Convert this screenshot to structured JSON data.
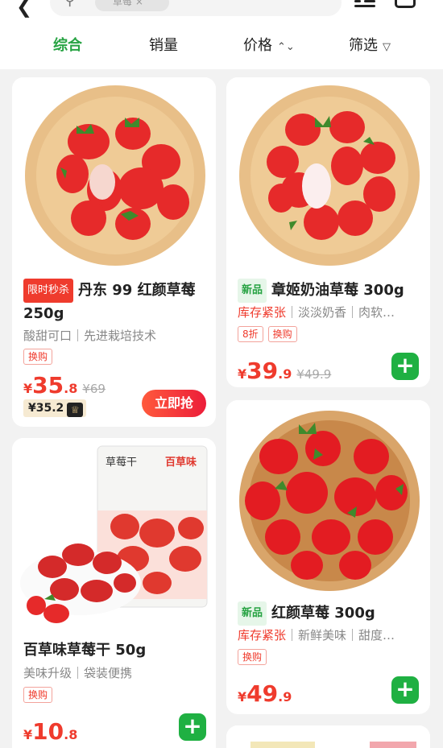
{
  "header": {
    "back_icon": "chevron-left-icon",
    "search_icon": "search-icon",
    "search_chip": "草莓 ×",
    "list_icon": "list-view-icon",
    "cart_icon": "cart-icon"
  },
  "tabs": [
    {
      "label": "综合",
      "active": true
    },
    {
      "label": "销量"
    },
    {
      "label": "价格",
      "icon": "⌃⌄"
    },
    {
      "label": "筛选",
      "icon": "▽"
    }
  ],
  "products": [
    {
      "tag": "限时秒杀",
      "title": "丹东 99 红颜草莓 250g",
      "desc": "酸甜可口｜先进栽培技术",
      "badges": [
        "换购"
      ],
      "price_int": "35",
      "price_dec": ".8",
      "orig_price": "¥69",
      "member_price": "¥35.2",
      "button": "立即抢"
    },
    {
      "tag": "新品",
      "title": "章姬奶油草莓 300g",
      "hot": "库存紧张",
      "desc": "｜淡淡奶香｜肉软…",
      "badges": [
        "8折",
        "换购"
      ],
      "price_int": "39",
      "price_dec": ".9",
      "orig_price": "¥49.9"
    },
    {
      "title": "百草味草莓干 50g",
      "desc": "美味升级｜袋装便携",
      "badges": [
        "换购"
      ],
      "price_int": "10",
      "price_dec": ".8",
      "package_text": "草莓干",
      "package_brand": "百草味"
    },
    {
      "tag": "新品",
      "title": "红颜草莓 300g",
      "hot": "库存紧张",
      "desc": "｜新鲜美味｜甜度…",
      "badges": [
        "换购"
      ],
      "price_int": "49",
      "price_dec": ".9"
    }
  ],
  "currency": "¥",
  "add_icon": "plus-icon",
  "member_icon": "member-crown-icon",
  "colors": {
    "accent_green": "#27a343",
    "price_red": "#ef3b2d",
    "add_green": "#1fb042"
  }
}
